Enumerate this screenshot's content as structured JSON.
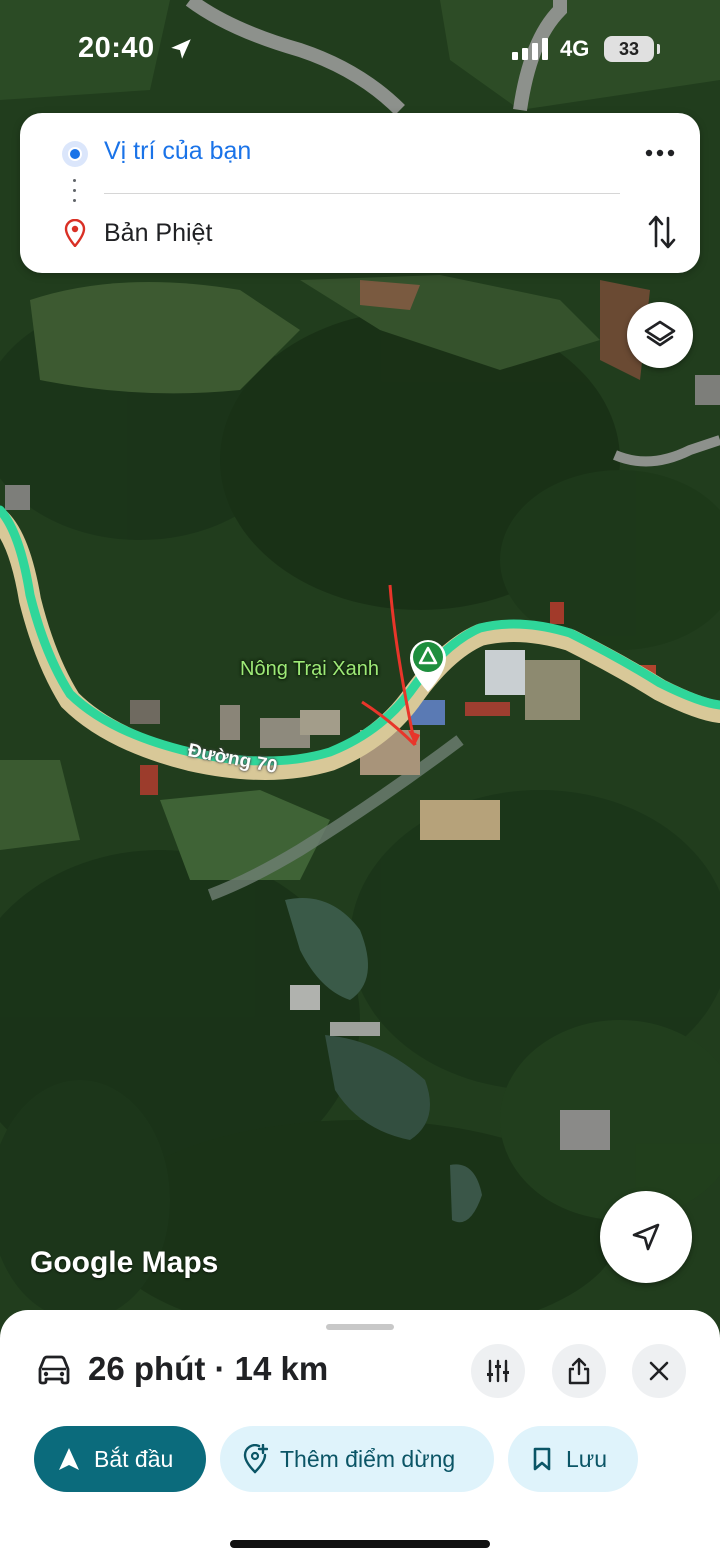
{
  "status_bar": {
    "time": "20:40",
    "network": "4G",
    "battery": "33"
  },
  "route": {
    "origin": "Vị trí của bạn",
    "destination": "Bản Phiệt"
  },
  "map": {
    "poi_name": "Nông Trại Xanh",
    "road_name": "Đường 70",
    "logo": "Google Maps",
    "route_color": "#2fd69a",
    "road_color": "#d8c898",
    "poi_color": "#1e8e3e",
    "annotation_color": "#e8352a"
  },
  "trip": {
    "summary": "26 phút · 14 km"
  },
  "actions": {
    "start": "Bắt đầu",
    "add_stop": "Thêm điểm dừng",
    "save": "Lưu"
  },
  "icons": {
    "origin": "blue-dot-icon",
    "destination": "red-pin-icon",
    "more": "more-horizontal-icon",
    "swap": "swap-vertical-icon",
    "layers": "layers-icon",
    "locate": "navigation-arrow-icon",
    "car": "car-icon",
    "options": "sliders-icon",
    "share": "share-icon",
    "close": "close-icon",
    "start": "navigation-icon",
    "add_stop": "add-location-icon",
    "save": "bookmark-icon"
  },
  "colors": {
    "accent": "#1a73e8",
    "primary_button": "#0b6b7c",
    "tonal_button": "#dff3fb"
  }
}
